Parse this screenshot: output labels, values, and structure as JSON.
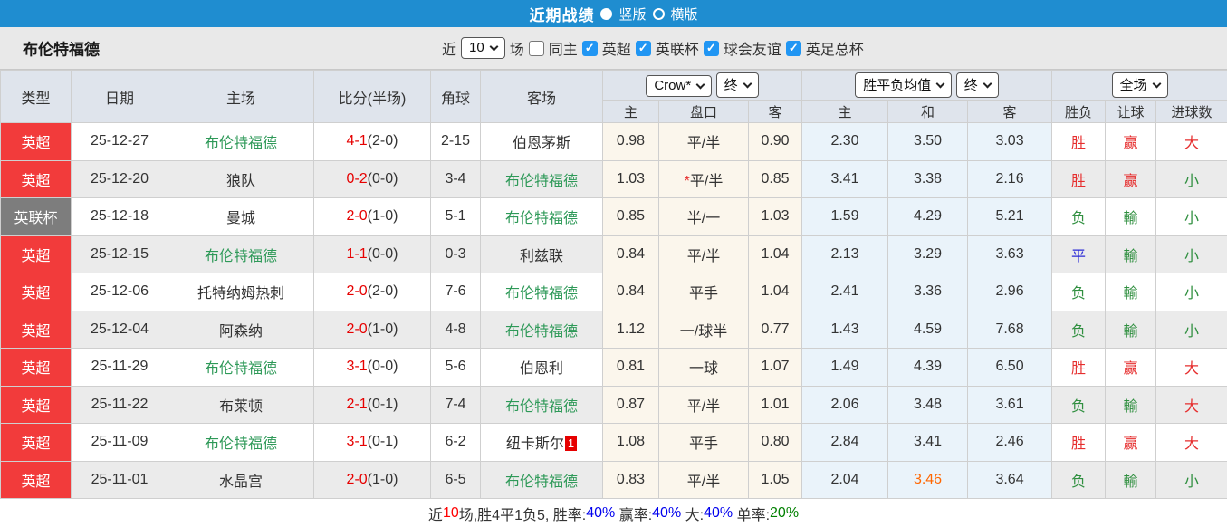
{
  "title_bar": {
    "title": "近期战绩",
    "radios": [
      {
        "label": "竖版",
        "selected": true
      },
      {
        "label": "横版",
        "selected": false
      }
    ]
  },
  "filter_bar": {
    "team": "布伦特福德",
    "near_label": "近",
    "match_count": "10",
    "games_label": "场",
    "same_host": {
      "label": "同主",
      "checked": false
    },
    "leagues": [
      {
        "label": "英超",
        "checked": true
      },
      {
        "label": "英联杯",
        "checked": true
      },
      {
        "label": "球会友谊",
        "checked": true
      },
      {
        "label": "英足总杯",
        "checked": true
      }
    ]
  },
  "table": {
    "static_headers": [
      "类型",
      "日期",
      "主场",
      "比分(半场)",
      "角球",
      "客场"
    ],
    "selectors": {
      "bookmaker": "Crow*",
      "bookmaker_state": "终",
      "avg": "胜平负均值",
      "avg_state": "终",
      "scope": "全场"
    },
    "sub_headers": [
      "主",
      "盘口",
      "客",
      "主",
      "和",
      "客",
      "胜负",
      "让球",
      "进球数"
    ],
    "rows": [
      {
        "league": "英超",
        "league_type": "red",
        "date": "25-12-27",
        "home": "布伦特福德",
        "home_team": true,
        "score": "4-1",
        "half": "(2-0)",
        "corner": "2-15",
        "away": "伯恩茅斯",
        "away_team": false,
        "away_badge": "",
        "crow_home": "0.98",
        "handicap": "平/半",
        "star": false,
        "crow_away": "0.90",
        "avg_home": "2.30",
        "avg_draw": "3.50",
        "avg_draw_hl": false,
        "avg_away": "3.03",
        "result": "胜",
        "result_c": "red",
        "let": "赢",
        "let_c": "red",
        "goal": "大",
        "goal_c": "red"
      },
      {
        "league": "英超",
        "league_type": "red",
        "date": "25-12-20",
        "home": "狼队",
        "home_team": false,
        "score": "0-2",
        "half": "(0-0)",
        "corner": "3-4",
        "away": "布伦特福德",
        "away_team": true,
        "away_badge": "",
        "crow_home": "1.03",
        "handicap": "平/半",
        "star": true,
        "crow_away": "0.85",
        "avg_home": "3.41",
        "avg_draw": "3.38",
        "avg_draw_hl": false,
        "avg_away": "2.16",
        "result": "胜",
        "result_c": "red",
        "let": "赢",
        "let_c": "red",
        "goal": "小",
        "goal_c": "green"
      },
      {
        "league": "英联杯",
        "league_type": "gray",
        "date": "25-12-18",
        "home": "曼城",
        "home_team": false,
        "score": "2-0",
        "half": "(1-0)",
        "corner": "5-1",
        "away": "布伦特福德",
        "away_team": true,
        "away_badge": "",
        "crow_home": "0.85",
        "handicap": "半/一",
        "star": false,
        "crow_away": "1.03",
        "avg_home": "1.59",
        "avg_draw": "4.29",
        "avg_draw_hl": false,
        "avg_away": "5.21",
        "result": "负",
        "result_c": "green",
        "let": "輸",
        "let_c": "green",
        "goal": "小",
        "goal_c": "green"
      },
      {
        "league": "英超",
        "league_type": "red",
        "date": "25-12-15",
        "home": "布伦特福德",
        "home_team": true,
        "score": "1-1",
        "half": "(0-0)",
        "corner": "0-3",
        "away": "利兹联",
        "away_team": false,
        "away_badge": "",
        "crow_home": "0.84",
        "handicap": "平/半",
        "star": false,
        "crow_away": "1.04",
        "avg_home": "2.13",
        "avg_draw": "3.29",
        "avg_draw_hl": false,
        "avg_away": "3.63",
        "result": "平",
        "result_c": "blue",
        "let": "輸",
        "let_c": "green",
        "goal": "小",
        "goal_c": "green"
      },
      {
        "league": "英超",
        "league_type": "red",
        "date": "25-12-06",
        "home": "托特纳姆热刺",
        "home_team": false,
        "score": "2-0",
        "half": "(2-0)",
        "corner": "7-6",
        "away": "布伦特福德",
        "away_team": true,
        "away_badge": "",
        "crow_home": "0.84",
        "handicap": "平手",
        "star": false,
        "crow_away": "1.04",
        "avg_home": "2.41",
        "avg_draw": "3.36",
        "avg_draw_hl": false,
        "avg_away": "2.96",
        "result": "负",
        "result_c": "green",
        "let": "輸",
        "let_c": "green",
        "goal": "小",
        "goal_c": "green"
      },
      {
        "league": "英超",
        "league_type": "red",
        "date": "25-12-04",
        "home": "阿森纳",
        "home_team": false,
        "score": "2-0",
        "half": "(1-0)",
        "corner": "4-8",
        "away": "布伦特福德",
        "away_team": true,
        "away_badge": "",
        "crow_home": "1.12",
        "handicap": "一/球半",
        "star": false,
        "crow_away": "0.77",
        "avg_home": "1.43",
        "avg_draw": "4.59",
        "avg_draw_hl": false,
        "avg_away": "7.68",
        "result": "负",
        "result_c": "green",
        "let": "輸",
        "let_c": "green",
        "goal": "小",
        "goal_c": "green"
      },
      {
        "league": "英超",
        "league_type": "red",
        "date": "25-11-29",
        "home": "布伦特福德",
        "home_team": true,
        "score": "3-1",
        "half": "(0-0)",
        "corner": "5-6",
        "away": "伯恩利",
        "away_team": false,
        "away_badge": "",
        "crow_home": "0.81",
        "handicap": "一球",
        "star": false,
        "crow_away": "1.07",
        "avg_home": "1.49",
        "avg_draw": "4.39",
        "avg_draw_hl": false,
        "avg_away": "6.50",
        "result": "胜",
        "result_c": "red",
        "let": "赢",
        "let_c": "red",
        "goal": "大",
        "goal_c": "red"
      },
      {
        "league": "英超",
        "league_type": "red",
        "date": "25-11-22",
        "home": "布莱顿",
        "home_team": false,
        "score": "2-1",
        "half": "(0-1)",
        "corner": "7-4",
        "away": "布伦特福德",
        "away_team": true,
        "away_badge": "",
        "crow_home": "0.87",
        "handicap": "平/半",
        "star": false,
        "crow_away": "1.01",
        "avg_home": "2.06",
        "avg_draw": "3.48",
        "avg_draw_hl": false,
        "avg_away": "3.61",
        "result": "负",
        "result_c": "green",
        "let": "輸",
        "let_c": "green",
        "goal": "大",
        "goal_c": "red"
      },
      {
        "league": "英超",
        "league_type": "red",
        "date": "25-11-09",
        "home": "布伦特福德",
        "home_team": true,
        "score": "3-1",
        "half": "(0-1)",
        "corner": "6-2",
        "away": "纽卡斯尔",
        "away_team": false,
        "away_badge": "1",
        "crow_home": "1.08",
        "handicap": "平手",
        "star": false,
        "crow_away": "0.80",
        "avg_home": "2.84",
        "avg_draw": "3.41",
        "avg_draw_hl": false,
        "avg_away": "2.46",
        "result": "胜",
        "result_c": "red",
        "let": "赢",
        "let_c": "red",
        "goal": "大",
        "goal_c": "red"
      },
      {
        "league": "英超",
        "league_type": "red",
        "date": "25-11-01",
        "home": "水晶宫",
        "home_team": false,
        "score": "2-0",
        "half": "(1-0)",
        "corner": "6-5",
        "away": "布伦特福德",
        "away_team": true,
        "away_badge": "",
        "crow_home": "0.83",
        "handicap": "平/半",
        "star": false,
        "crow_away": "1.05",
        "avg_home": "2.04",
        "avg_draw": "3.46",
        "avg_draw_hl": true,
        "avg_away": "3.64",
        "result": "负",
        "result_c": "green",
        "let": "輸",
        "let_c": "green",
        "goal": "小",
        "goal_c": "green"
      }
    ]
  },
  "footer": {
    "segments": [
      {
        "text": "近",
        "color": "#333333"
      },
      {
        "text": "10",
        "color": "#ff0000"
      },
      {
        "text": "场,胜4平1负5, 胜率:",
        "color": "#333333"
      },
      {
        "text": "40%",
        "color": "#0000ee"
      },
      {
        "text": " 赢率:",
        "color": "#333333"
      },
      {
        "text": "40%",
        "color": "#0000ee"
      },
      {
        "text": " 大:",
        "color": "#333333"
      },
      {
        "text": "40%",
        "color": "#0000ee"
      },
      {
        "text": " 单率:",
        "color": "#333333"
      },
      {
        "text": "20%",
        "color": "#008000"
      }
    ]
  },
  "colors": {
    "red": "#e62e2e",
    "green": "#2f8f3f",
    "blue": "#2929d6",
    "orange": "#ff6600",
    "team_green": "#2e9958",
    "score_red": "#e60000",
    "text_dark": "#333333",
    "badge_red": "#f23b3b",
    "badge_gray": "#7d7d7d",
    "accent_blue": "#1f8dd0"
  }
}
